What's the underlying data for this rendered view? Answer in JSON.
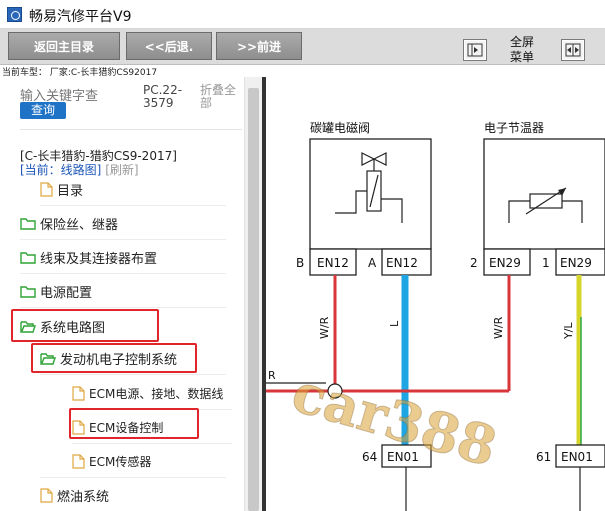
{
  "window": {
    "title": "畅易汽修平台V9"
  },
  "toolbar": {
    "home_label": "返回主目录",
    "back_label": "<<后退.",
    "forward_label": ">>前进",
    "fullscreen_line1": "全屏",
    "fullscreen_line2": "菜单"
  },
  "model_line": "当前车型： 厂家:C-长丰猎豹CS92017",
  "sidebar": {
    "search_hint": "输入关键字查",
    "query_label": "查询",
    "code_text": "PC.22-3579",
    "fold_all_label": "折叠全部",
    "vehicle_title": "[C-长丰猎豹-猎豹CS9-2017]",
    "current_label": "[当前：线路图]",
    "refresh_label": "[刷新]",
    "items": [
      {
        "label": "目录"
      },
      {
        "label": "保险丝、继器"
      },
      {
        "label": "线束及其连接器布置"
      },
      {
        "label": "电源配置"
      },
      {
        "label": "系统电路图"
      },
      {
        "label": "发动机电子控制系统"
      },
      {
        "label": "ECM电源、接地、数据线"
      },
      {
        "label": "ECM设备控制"
      },
      {
        "label": "ECM传感器"
      },
      {
        "label": "燃油系统"
      }
    ]
  },
  "diagram": {
    "component1": "碳罐电磁阀",
    "component2": "电子节温器",
    "pin_b": "B",
    "pin_a": "A",
    "pin_2": "2",
    "pin_1": "1",
    "conn_en12": "EN12",
    "conn_en29": "EN29",
    "conn_en01": "EN01",
    "pin_64": "64",
    "pin_61": "61",
    "wire_wr": "W/R",
    "wire_l": "L",
    "wire_yl": "Y/L",
    "wire_r": "R",
    "watermark": "car388"
  },
  "colors": {
    "wire_red": "#d9363b",
    "wire_blue": "#1ea5e3",
    "wire_yellow": "#d6d62a",
    "wire_green": "#2fa84a",
    "folder_green": "#2ea335",
    "highlight_red": "#e0262a"
  }
}
